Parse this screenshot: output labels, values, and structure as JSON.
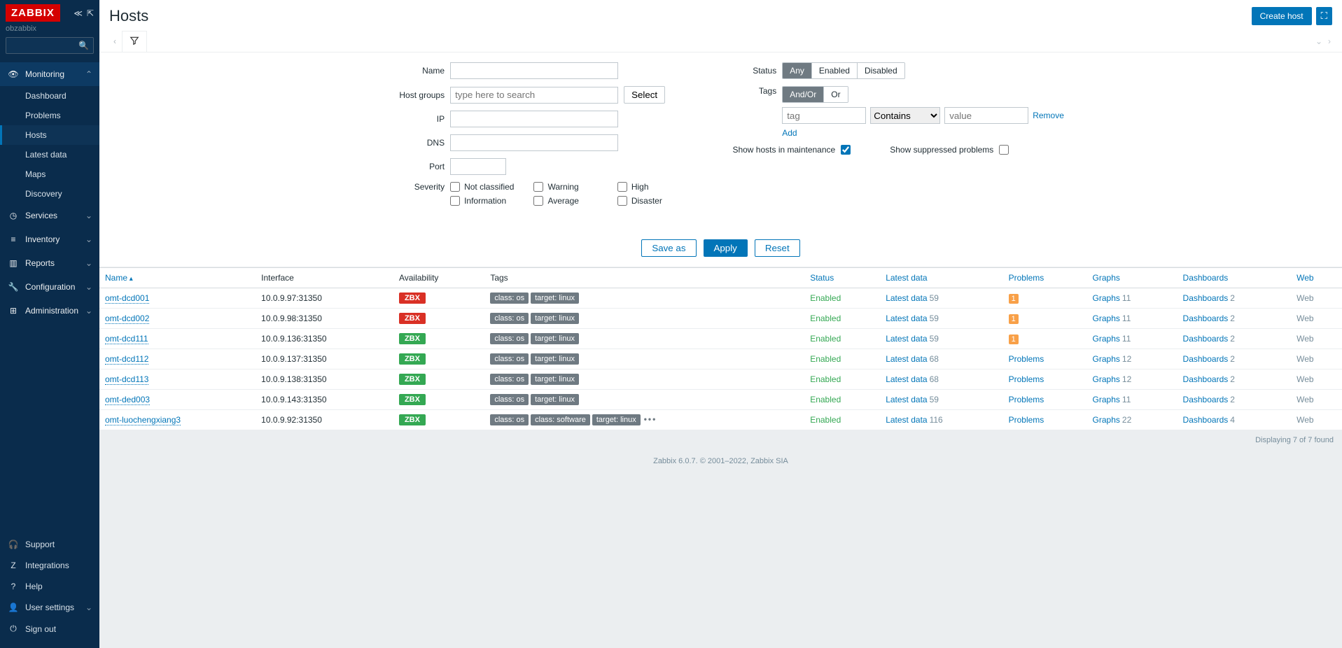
{
  "brand": "ZABBIX",
  "server_name": "obzabbix",
  "page_title": "Hosts",
  "header_actions": {
    "create_host": "Create host"
  },
  "sidebar": {
    "groups": [
      {
        "label": "Monitoring",
        "icon": "👁",
        "expanded": true,
        "items": [
          {
            "label": "Dashboard"
          },
          {
            "label": "Problems"
          },
          {
            "label": "Hosts",
            "selected": true
          },
          {
            "label": "Latest data"
          },
          {
            "label": "Maps"
          },
          {
            "label": "Discovery"
          }
        ]
      },
      {
        "label": "Services",
        "icon": "◷"
      },
      {
        "label": "Inventory",
        "icon": "≡"
      },
      {
        "label": "Reports",
        "icon": "▥"
      },
      {
        "label": "Configuration",
        "icon": "🔧"
      },
      {
        "label": "Administration",
        "icon": "⊞"
      }
    ],
    "bottom": [
      {
        "label": "Support",
        "icon": "🎧"
      },
      {
        "label": "Integrations",
        "icon": "Z"
      },
      {
        "label": "Help",
        "icon": "?"
      },
      {
        "label": "User settings",
        "icon": "👤",
        "chev": true
      },
      {
        "label": "Sign out",
        "icon": "⏻"
      }
    ]
  },
  "filter": {
    "labels": {
      "name": "Name",
      "host_groups": "Host groups",
      "ip": "IP",
      "dns": "DNS",
      "port": "Port",
      "severity": "Severity",
      "status": "Status",
      "tags": "Tags",
      "show_maint": "Show hosts in maintenance",
      "show_suppressed": "Show suppressed problems"
    },
    "host_groups_placeholder": "type here to search",
    "select_btn": "Select",
    "status_options": [
      "Any",
      "Enabled",
      "Disabled"
    ],
    "tags_logic": [
      "And/Or",
      "Or"
    ],
    "tag_name_placeholder": "tag",
    "tag_op": "Contains",
    "tag_value_placeholder": "value",
    "tag_remove": "Remove",
    "tag_add": "Add",
    "show_maint_checked": true,
    "show_suppressed_checked": false,
    "severities": [
      "Not classified",
      "Warning",
      "High",
      "Information",
      "Average",
      "Disaster"
    ],
    "buttons": {
      "save_as": "Save as",
      "apply": "Apply",
      "reset": "Reset"
    }
  },
  "table": {
    "columns": [
      "Name",
      "Interface",
      "Availability",
      "Tags",
      "Status",
      "Latest data",
      "Problems",
      "Graphs",
      "Dashboards",
      "Web"
    ],
    "rows": [
      {
        "name": "omt-dcd001",
        "interface": "10.0.9.97:31350",
        "avail": "red",
        "tags": [
          "class: os",
          "target: linux"
        ],
        "status": "Enabled",
        "latest": 59,
        "problems_count": 1,
        "problems_link": false,
        "graphs": 11,
        "dashboards": 2,
        "web": "Web"
      },
      {
        "name": "omt-dcd002",
        "interface": "10.0.9.98:31350",
        "avail": "red",
        "tags": [
          "class: os",
          "target: linux"
        ],
        "status": "Enabled",
        "latest": 59,
        "problems_count": 1,
        "problems_link": false,
        "graphs": 11,
        "dashboards": 2,
        "web": "Web"
      },
      {
        "name": "omt-dcd111",
        "interface": "10.0.9.136:31350",
        "avail": "green",
        "tags": [
          "class: os",
          "target: linux"
        ],
        "status": "Enabled",
        "latest": 59,
        "problems_count": 1,
        "problems_link": false,
        "graphs": 11,
        "dashboards": 2,
        "web": "Web"
      },
      {
        "name": "omt-dcd112",
        "interface": "10.0.9.137:31350",
        "avail": "green",
        "tags": [
          "class: os",
          "target: linux"
        ],
        "status": "Enabled",
        "latest": 68,
        "problems_count": null,
        "problems_link": true,
        "graphs": 12,
        "dashboards": 2,
        "web": "Web"
      },
      {
        "name": "omt-dcd113",
        "interface": "10.0.9.138:31350",
        "avail": "green",
        "tags": [
          "class: os",
          "target: linux"
        ],
        "status": "Enabled",
        "latest": 68,
        "problems_count": null,
        "problems_link": true,
        "graphs": 12,
        "dashboards": 2,
        "web": "Web"
      },
      {
        "name": "omt-ded003",
        "interface": "10.0.9.143:31350",
        "avail": "green",
        "tags": [
          "class: os",
          "target: linux"
        ],
        "status": "Enabled",
        "latest": 59,
        "problems_count": null,
        "problems_link": true,
        "graphs": 11,
        "dashboards": 2,
        "web": "Web"
      },
      {
        "name": "omt-luochengxiang3",
        "interface": "10.0.9.92:31350",
        "avail": "green",
        "tags": [
          "class: os",
          "class: software",
          "target: linux"
        ],
        "more": true,
        "status": "Enabled",
        "latest": 116,
        "problems_count": null,
        "problems_link": true,
        "graphs": 22,
        "dashboards": 4,
        "web": "Web"
      }
    ],
    "latest_label": "Latest data",
    "problems_label": "Problems",
    "graphs_label": "Graphs",
    "dashboards_label": "Dashboards",
    "avail_label": "ZBX",
    "footer": "Displaying 7 of 7 found"
  },
  "page_footer": "Zabbix 6.0.7. © 2001–2022, Zabbix SIA"
}
